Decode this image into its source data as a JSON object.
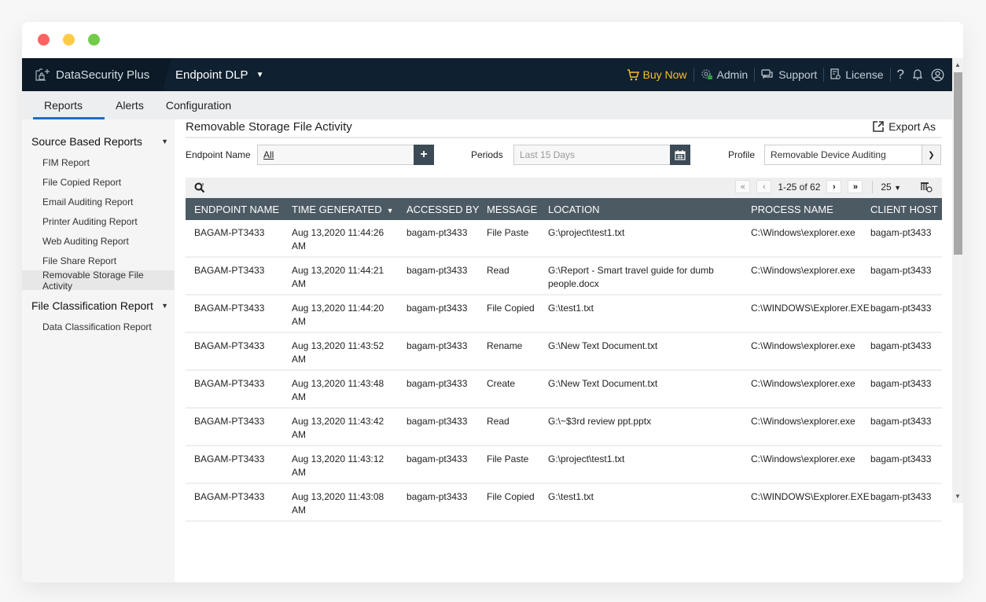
{
  "window": {
    "controls": [
      "close",
      "minimize",
      "maximize"
    ]
  },
  "topnav": {
    "brand": "DataSecurity Plus",
    "module": "Endpoint DLP",
    "buy_now": "Buy Now",
    "admin": "Admin",
    "support": "Support",
    "license": "License",
    "help": "?",
    "colors": {
      "background": "#0f2030",
      "buy_now": "#f6c02a"
    }
  },
  "subnav": {
    "tabs": [
      {
        "label": "Reports",
        "active": true
      },
      {
        "label": "Alerts",
        "active": false
      },
      {
        "label": "Configuration",
        "active": false
      }
    ]
  },
  "sidebar": {
    "groups": [
      {
        "title": "Source Based Reports",
        "items": [
          {
            "label": "FIM Report"
          },
          {
            "label": "File Copied Report"
          },
          {
            "label": "Email Auditing Report"
          },
          {
            "label": "Printer Auditing Report"
          },
          {
            "label": "Web Auditing Report"
          },
          {
            "label": "File Share Report"
          },
          {
            "label": "Removable Storage File Activity",
            "active": true
          }
        ]
      },
      {
        "title": "File Classification Report",
        "items": [
          {
            "label": "Data Classification Report"
          }
        ]
      }
    ]
  },
  "main": {
    "title": "Removable Storage File Activity",
    "export_label": "Export As",
    "filters": {
      "endpoint_label": "Endpoint Name",
      "endpoint_value": "All",
      "periods_label": "Periods",
      "periods_placeholder": "Last 15 Days",
      "profile_label": "Profile",
      "profile_value": "Removable Device Auditing"
    },
    "pager": {
      "range": "1-25 of 62",
      "page_size": "25"
    },
    "table": {
      "columns": [
        "ENDPOINT NAME",
        "TIME GENERATED",
        "ACCESSED BY",
        "MESSAGE",
        "LOCATION",
        "PROCESS NAME",
        "CLIENT HOST"
      ],
      "sorted_column": "TIME GENERATED",
      "rows": [
        [
          "BAGAM-PT3433",
          "Aug 13,2020 11:44:26 AM",
          "bagam-pt3433",
          "File Paste",
          "G:\\project\\test1.txt",
          "C:\\Windows\\explorer.exe",
          "bagam-pt3433"
        ],
        [
          "BAGAM-PT3433",
          "Aug 13,2020 11:44:21 AM",
          "bagam-pt3433",
          "Read",
          "G:\\Report - Smart travel guide for dumb people.docx",
          "C:\\Windows\\explorer.exe",
          "bagam-pt3433"
        ],
        [
          "BAGAM-PT3433",
          "Aug 13,2020 11:44:20 AM",
          "bagam-pt3433",
          "File Copied",
          "G:\\test1.txt",
          "C:\\WINDOWS\\Explorer.EXE",
          "bagam-pt3433"
        ],
        [
          "BAGAM-PT3433",
          "Aug 13,2020 11:43:52 AM",
          "bagam-pt3433",
          "Rename",
          "G:\\New Text Document.txt",
          "C:\\Windows\\explorer.exe",
          "bagam-pt3433"
        ],
        [
          "BAGAM-PT3433",
          "Aug 13,2020 11:43:48 AM",
          "bagam-pt3433",
          "Create",
          "G:\\New Text Document.txt",
          "C:\\Windows\\explorer.exe",
          "bagam-pt3433"
        ],
        [
          "BAGAM-PT3433",
          "Aug 13,2020 11:43:42 AM",
          "bagam-pt3433",
          "Read",
          "G:\\~$3rd review ppt.pptx",
          "C:\\Windows\\explorer.exe",
          "bagam-pt3433"
        ],
        [
          "BAGAM-PT3433",
          "Aug 13,2020 11:43:12 AM",
          "bagam-pt3433",
          "File Paste",
          "G:\\project\\test1.txt",
          "C:\\Windows\\explorer.exe",
          "bagam-pt3433"
        ],
        [
          "BAGAM-PT3433",
          "Aug 13,2020 11:43:08 AM",
          "bagam-pt3433",
          "File Copied",
          "G:\\test1.txt",
          "C:\\WINDOWS\\Explorer.EXE",
          "bagam-pt3433"
        ]
      ]
    }
  }
}
